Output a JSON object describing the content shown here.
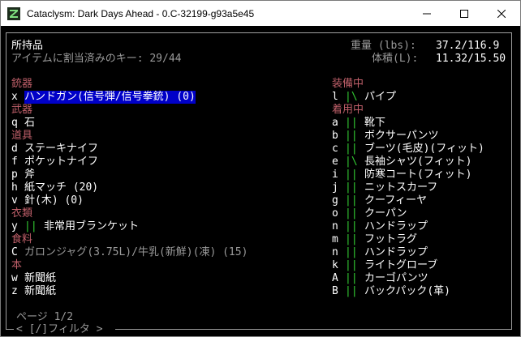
{
  "window": {
    "title": "Cataclysm: Dark Days Ahead - 0.C-32199-g93a5e45"
  },
  "header": {
    "title": "所持品",
    "hotkey_label": "アイテムに割当済みのキー: 29/44",
    "weight_label": "重量 (lbs):",
    "weight_value": "37.2/116.9",
    "volume_label": "体積(L):",
    "volume_value": "11.32/15.50"
  },
  "left_column": [
    {
      "type": "category",
      "text": "銃器"
    },
    {
      "type": "item",
      "key": "x",
      "name": "ハンドガン(信号弾/信号拳銃) (0)",
      "selected": true
    },
    {
      "type": "category",
      "text": "武器"
    },
    {
      "type": "item",
      "key": "q",
      "name": "石"
    },
    {
      "type": "category",
      "text": "道具"
    },
    {
      "type": "item",
      "key": "d",
      "name": "ステーキナイフ"
    },
    {
      "type": "item",
      "key": "f",
      "name": "ポケットナイフ"
    },
    {
      "type": "item",
      "key": "p",
      "name": "斧"
    },
    {
      "type": "item",
      "key": "h",
      "name": "紙マッチ (20)"
    },
    {
      "type": "item",
      "key": "v",
      "name": "針(木) (0)"
    },
    {
      "type": "category",
      "text": "衣類"
    },
    {
      "type": "item",
      "key": "y",
      "marker": "||",
      "name": "非常用ブランケット"
    },
    {
      "type": "category",
      "text": "食料"
    },
    {
      "type": "item",
      "key": "C",
      "name": "ガロンジャグ(3.75L)/牛乳(新鮮)(凍) (15)",
      "dim": true
    },
    {
      "type": "category",
      "text": "本"
    },
    {
      "type": "item",
      "key": "w",
      "name": "新聞紙"
    },
    {
      "type": "item",
      "key": "z",
      "name": "新聞紙"
    }
  ],
  "right_column": [
    {
      "type": "category",
      "text": "装備中"
    },
    {
      "type": "item",
      "key": "l",
      "marker": "|\\",
      "name": "パイプ"
    },
    {
      "type": "category",
      "text": "着用中"
    },
    {
      "type": "item",
      "key": "a",
      "marker": "||",
      "name": "靴下"
    },
    {
      "type": "item",
      "key": "b",
      "marker": "||",
      "name": "ボクサーパンツ"
    },
    {
      "type": "item",
      "key": "c",
      "marker": "||",
      "name": "ブーツ(毛皮)(フィット)"
    },
    {
      "type": "item",
      "key": "e",
      "marker": "|\\",
      "name": "長袖シャツ(フィット)"
    },
    {
      "type": "item",
      "key": "i",
      "marker": "||",
      "name": "防寒コート(フィット)"
    },
    {
      "type": "item",
      "key": "j",
      "marker": "||",
      "name": "ニットスカーフ"
    },
    {
      "type": "item",
      "key": "g",
      "marker": "||",
      "name": "クーフィーヤ"
    },
    {
      "type": "item",
      "key": "o",
      "marker": "||",
      "name": "クーパン"
    },
    {
      "type": "item",
      "key": "n",
      "marker": "||",
      "name": "ハンドラップ"
    },
    {
      "type": "item",
      "key": "m",
      "marker": "||",
      "name": "フットラグ"
    },
    {
      "type": "item",
      "key": "n",
      "marker": "||",
      "name": "ハンドラップ"
    },
    {
      "type": "item",
      "key": "k",
      "marker": "||",
      "name": "ライトグローブ"
    },
    {
      "type": "item",
      "key": "A",
      "marker": "||",
      "name": "カーゴパンツ"
    },
    {
      "type": "item",
      "key": "B",
      "marker": "||",
      "name": "バックパック(革)"
    }
  ],
  "footer": {
    "page": "ページ 1/2",
    "filter": "< [/]フィルタ >"
  },
  "colors": {
    "category": "#c0606a",
    "highlight": "#0000c8",
    "marker": "#33cc33"
  }
}
